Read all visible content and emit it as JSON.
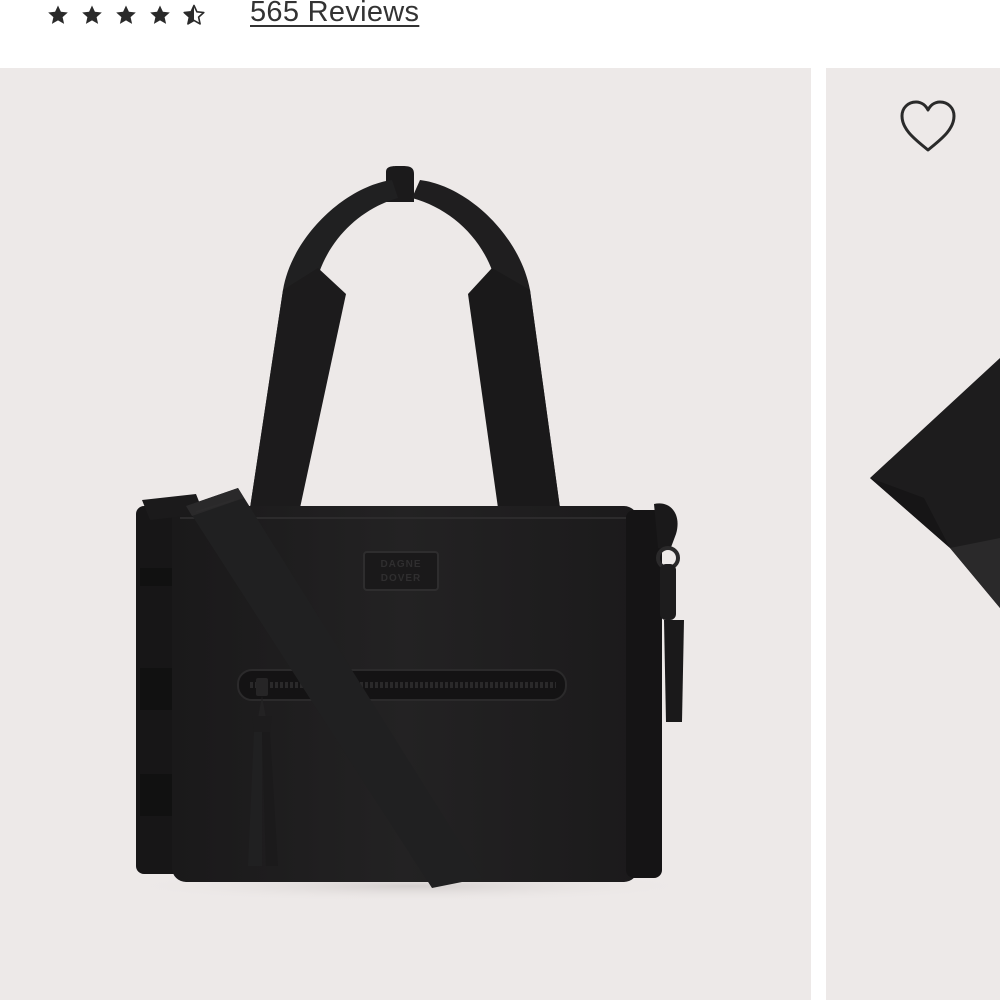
{
  "product": {
    "rating": 4.5,
    "rating_max": 5,
    "reviews_label": "565 Reviews"
  },
  "gallery": {
    "background_color": "#ede9e8",
    "bag_color": "#1e1d1e",
    "icons": {
      "wishlist": "heart-icon",
      "star": "star-icon",
      "half_star": "half-star-icon"
    }
  },
  "colors": {
    "star": "#2a2a2a",
    "text": "#333333"
  }
}
